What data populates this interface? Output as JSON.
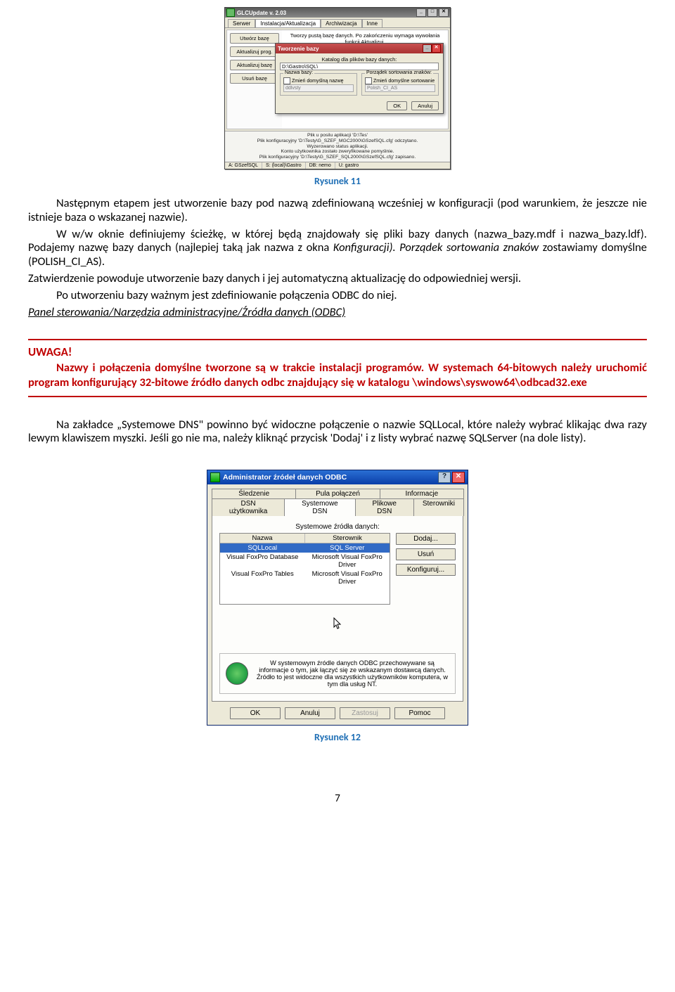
{
  "figure1": {
    "window_title": "GLCUpdate v. 2.03",
    "tabs": [
      "Serwer",
      "Instalacja/Aktualizacja",
      "Archiwizacja",
      "Inne"
    ],
    "side_buttons": [
      "Utwórz bazę",
      "Aktualizuj prog.",
      "Aktualizuj bazę",
      "Usuń bazę"
    ],
    "top_desc": "Tworzy pustą bazę danych. Po zakończeniu wymaga wywołania funkcji Aktualizuj.",
    "modal_title": "Tworzenie bazy",
    "modal_label_dir": "Katalog dla plików bazy danych:",
    "modal_dir_value": "D:\\Gastro\\SQL\\",
    "group_name_title": "Nazwa bazy:",
    "chk_name": "Zmień domyślną nazwę",
    "name_value": "ddlvsty",
    "group_sort_title": "Porządek sortowania znaków:",
    "chk_sort": "Zmień domyślne sortowanie",
    "sort_value": "Polish_CI_AS",
    "ok": "OK",
    "cancel": "Anuluj",
    "log1": "Plik u posilu aplikacji 'D:\\Tes'",
    "log2": "Plik konfiguracyjny 'D:\\Testy\\G_SZEF_MGC2000\\GSzefSQL.cfg' odczytano.",
    "log3": "Wyzerowano status aplikacji.",
    "log4": "Konto użytkownika zostało zweryfikowane pomyślnie.",
    "log5": "Plik konfiguracyjny 'D:\\Testy\\G_SZEF_SQL2000\\GSzefSQL.cfg' zapisano.",
    "status": {
      "a": "A: GSzefSQL",
      "s": "S: (local)\\Gastro",
      "db": "DB: nemo",
      "u": "U: gastro"
    },
    "caption": "Rysunek 11"
  },
  "para1a": "Następnym etapem jest utworzenie bazy pod nazwą zdefiniowaną wcześniej w konfiguracji (pod warunkiem, że jeszcze nie istnieje baza o wskazanej nazwie).",
  "para1b": "W w/w oknie definiujemy ścieżkę, w której będą znajdowały się pliki bazy danych (nazwa_bazy.mdf i nazwa_bazy.ldf). Podajemy nazwę bazy danych (najlepiej taką jak nazwa z okna ",
  "para1b_it": "Konfiguracji). Porządek sortowania znaków ",
  "para1b_post": "zostawiamy domyślne (POLISH_CI_AS).",
  "para1c": "Zatwierdzenie powoduje utworzenie bazy danych i jej automatyczną aktualizację do odpowiedniej wersji.",
  "para1d": "Po utworzeniu bazy ważnym jest zdefiniowanie połączenia ODBC do niej.",
  "para1e": "Panel sterowania/Narzędzia administracyjne/Źródła danych (ODBC)",
  "warning_title": "UWAGA!",
  "warning_body": "Nazwy i połączenia domyślne tworzone są w trakcie instalacji programów. W systemach 64-bitowych należy uruchomić program konfigurujący 32-bitowe źródło danych odbc znajdujący się w katalogu \\windows\\syswow64\\odbcad32.exe",
  "para2": "Na zakładce „Systemowe DNS\" powinno być widoczne połączenie o nazwie SQLLocal, które należy wybrać klikając dwa razy lewym klawiszem myszki. Jeśli go nie ma, należy kliknąć przycisk 'Dodaj' i z listy wybrać nazwę SQLServer (na dole listy).",
  "figure2": {
    "window_title": "Administrator źródeł danych ODBC",
    "tabs_top": [
      "Śledzenie",
      "Pula połączeń",
      "Informacje"
    ],
    "tabs_bottom": [
      "DSN użytkownika",
      "Systemowe DSN",
      "Plikowe DSN",
      "Sterowniki"
    ],
    "list_label": "Systemowe źródła danych:",
    "col_name": "Nazwa",
    "col_driver": "Sterownik",
    "rows": [
      {
        "name": "SQLLocal",
        "driver": "SQL Server"
      },
      {
        "name": "Visual FoxPro Database",
        "driver": "Microsoft Visual FoxPro Driver"
      },
      {
        "name": "Visual FoxPro Tables",
        "driver": "Microsoft Visual FoxPro Driver"
      }
    ],
    "btn_add": "Dodaj...",
    "btn_remove": "Usuń",
    "btn_config": "Konfiguruj...",
    "info_text": "W systemowym źródle danych ODBC przechowywane są informacje o tym, jak łączyć się ze wskazanym dostawcą danych. Źródło to jest widoczne dla wszystkich użytkowników komputera, w tym dla usług NT.",
    "btn_ok": "OK",
    "btn_cancel": "Anuluj",
    "btn_apply": "Zastosuj",
    "btn_help": "Pomoc",
    "caption": "Rysunek 12"
  },
  "page_number": "7"
}
